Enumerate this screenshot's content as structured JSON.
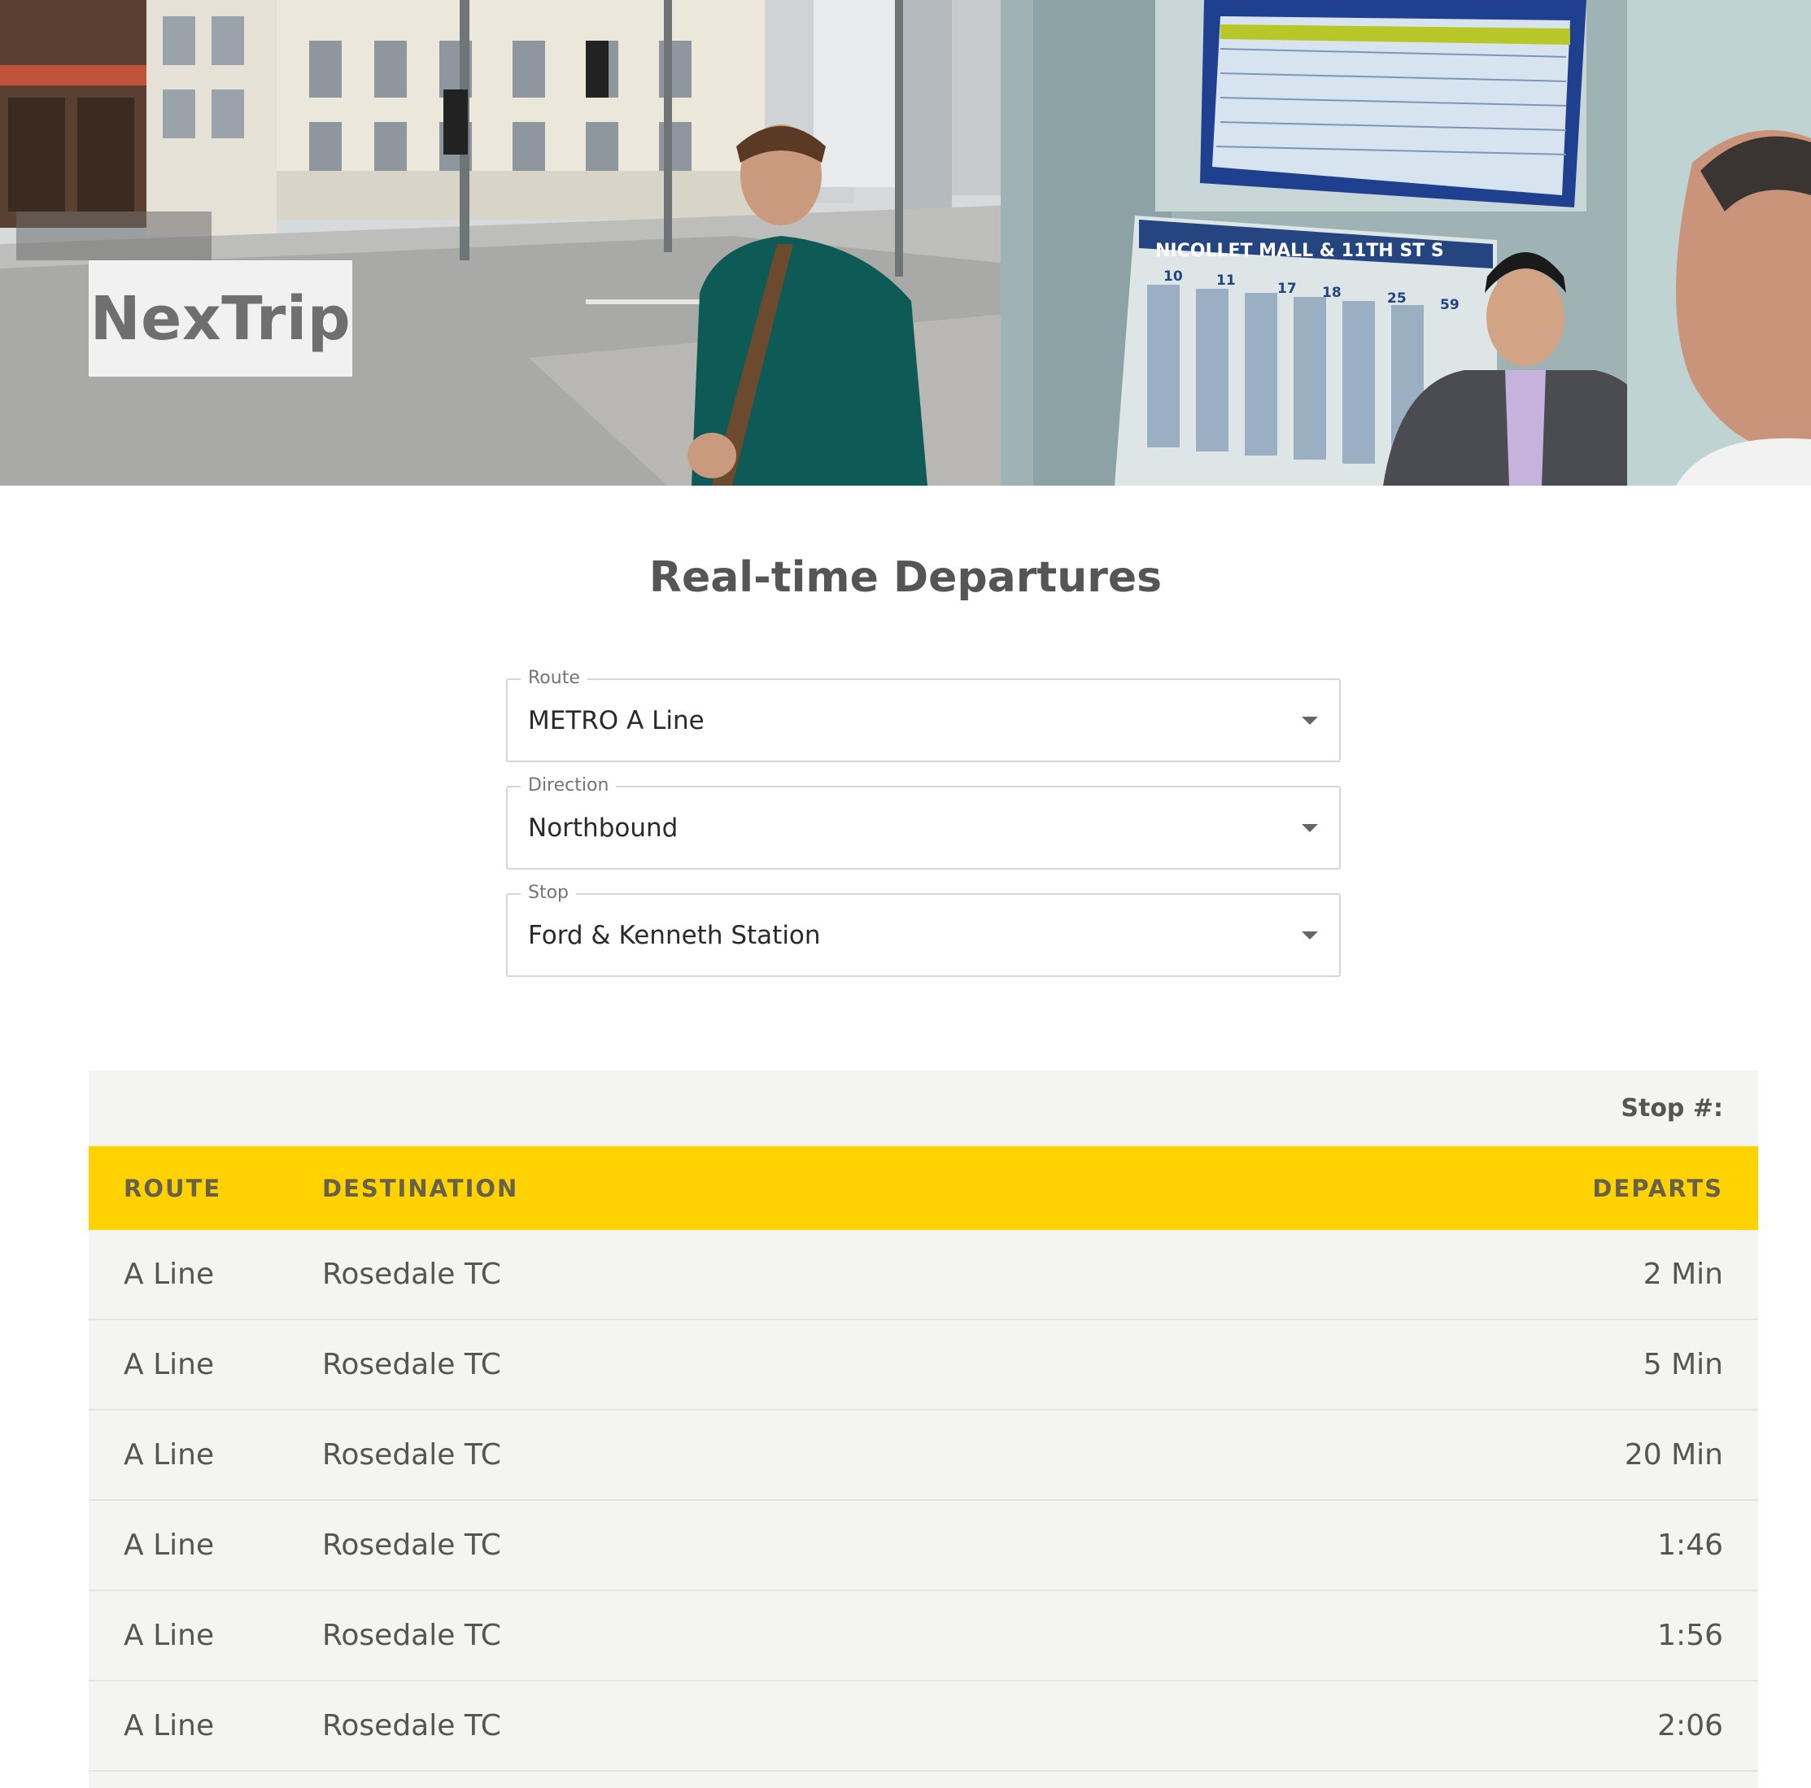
{
  "hero": {
    "logo": "NexTrip",
    "sign_text": "NICOLLET MALL & 11TH ST S",
    "sign_routes": [
      "10",
      "11",
      "17",
      "18",
      "25",
      "59"
    ]
  },
  "page_title": "Real-time Departures",
  "filters": {
    "route": {
      "label": "Route",
      "value": "METRO A Line"
    },
    "direction": {
      "label": "Direction",
      "value": "Northbound"
    },
    "stop": {
      "label": "Stop",
      "value": "Ford & Kenneth Station"
    }
  },
  "table": {
    "stop_label": "Stop #:",
    "headers": {
      "route": "ROUTE",
      "destination": "DESTINATION",
      "departs": "DEPARTS"
    },
    "rows": [
      {
        "route": "A Line",
        "destination": "Rosedale TC",
        "departs": "2 Min"
      },
      {
        "route": "A Line",
        "destination": "Rosedale TC",
        "departs": "5 Min"
      },
      {
        "route": "A Line",
        "destination": "Rosedale TC",
        "departs": "20 Min"
      },
      {
        "route": "A Line",
        "destination": "Rosedale TC",
        "departs": "1:46"
      },
      {
        "route": "A Line",
        "destination": "Rosedale TC",
        "departs": "1:56"
      },
      {
        "route": "A Line",
        "destination": "Rosedale TC",
        "departs": "2:06"
      }
    ]
  },
  "colors": {
    "header_yellow": "#ffd200",
    "table_bg": "#f4f4f2",
    "title_gray": "#555555"
  }
}
